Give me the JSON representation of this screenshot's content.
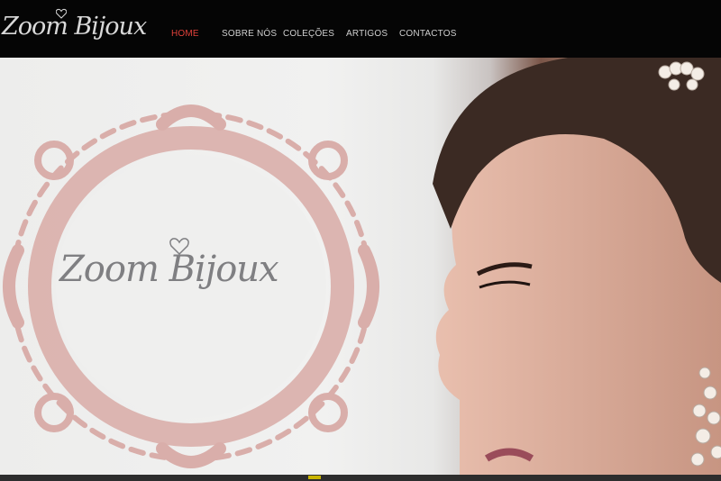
{
  "header": {
    "logo_text": "Zoom Bijoux",
    "nav": [
      {
        "label": "HOME",
        "active": true
      },
      {
        "label": "SOBRE NÓS",
        "active": false
      },
      {
        "label": "COLEÇÕES",
        "active": false
      },
      {
        "label": "ARTIGOS",
        "active": false
      },
      {
        "label": "CONTACTOS",
        "active": false
      }
    ],
    "active_color": "#e0413a"
  },
  "hero": {
    "logo_text": "Zoom Bijoux",
    "frame_color": "#d9aeaa",
    "image_subject": "model-profile-with-earring"
  }
}
